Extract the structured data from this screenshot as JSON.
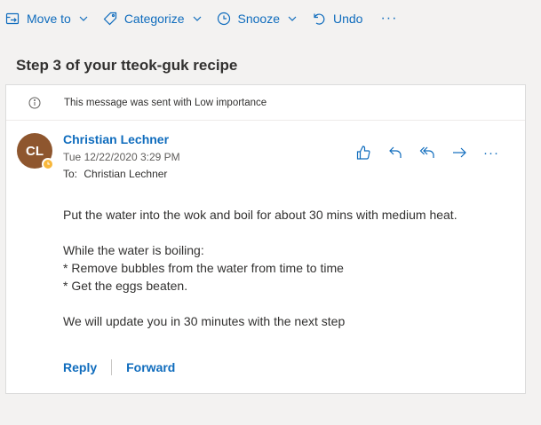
{
  "toolbar": {
    "move_to": "Move to",
    "categorize": "Categorize",
    "snooze": "Snooze",
    "undo": "Undo",
    "more": "···"
  },
  "message": {
    "subject": "Step 3 of your tteok-guk recipe",
    "importance_notice": "This message was sent with Low importance",
    "avatar_initials": "CL",
    "sender": "Christian Lechner",
    "date": "Tue 12/22/2020 3:29 PM",
    "to_label": "To:",
    "to": "Christian Lechner",
    "more": "···",
    "body": [
      "Put the water into the wok and boil for about 30 mins with medium heat.",
      "While the water is boiling:",
      "* Remove bubbles from the water from time to time",
      "* Get the eggs beaten.",
      "We will update you in 30 minutes with the next step"
    ],
    "reply": "Reply",
    "forward": "Forward"
  },
  "icons": {
    "toolbar": [
      "move-to-icon",
      "tag-icon",
      "clock-icon",
      "undo-icon",
      "chevron-down-icon"
    ],
    "actions": [
      "like-icon",
      "reply-icon",
      "reply-all-icon",
      "forward-icon"
    ],
    "info": "info-icon",
    "presence": "away-clock-icon"
  },
  "colors": {
    "accent": "#0f6cbd",
    "avatar": "#8e562e",
    "presence": "#f8b73b",
    "background": "#f3f2f1"
  }
}
